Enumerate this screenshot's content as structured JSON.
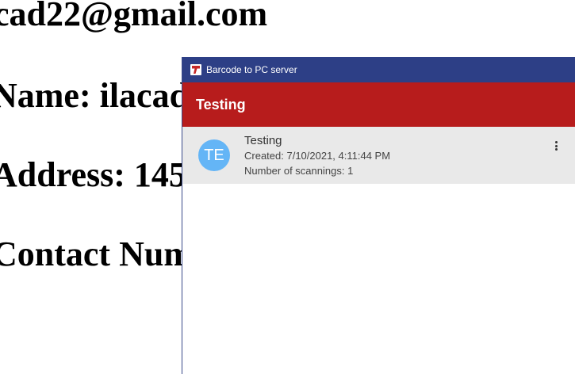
{
  "document": {
    "email_line": "cad22@gmail.com",
    "name_line": "Name: ilacad",
    "address_line": "Address: 145",
    "contact_line": "Contact Num"
  },
  "window": {
    "title": "Barcode to PC server",
    "header_title": "Testing",
    "items": [
      {
        "avatar_initials": "TE",
        "title": "Testing",
        "created": "Created: 7/10/2021, 4:11:44 PM",
        "scannings": "Number of scannings: 1"
      }
    ]
  },
  "icons": {
    "app": "barcode-to-pc-app-icon",
    "more": "more-vertical-icon"
  },
  "colors": {
    "titlebar": "#2d3f86",
    "header": "#b71c1c",
    "avatar": "#64b5f6",
    "list_item_bg": "#e9e9e9"
  }
}
